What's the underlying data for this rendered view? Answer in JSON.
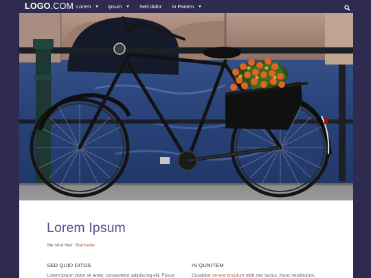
{
  "nav": {
    "logo_bold": "LOGO",
    "logo_thin": ".COM",
    "items": [
      {
        "label": "Lorem",
        "has_dropdown": true
      },
      {
        "label": "Ipsum",
        "has_dropdown": true
      },
      {
        "label": "Sed dolor",
        "has_dropdown": false
      },
      {
        "label": "In Panem",
        "has_dropdown": true
      }
    ],
    "search_icon": "search-icon"
  },
  "hero": {
    "image": "bicycle-with-tulips-on-canal-bridge"
  },
  "main": {
    "title": "Lorem Ipsum",
    "breadcrumb_prefix": "Sie sind hier:",
    "breadcrumb_link": "Startseite",
    "columns": [
      {
        "heading": "SED QUID DITOS",
        "text": "Lorem ipsum dolor sit amet, consectetur adipiscing elit. Fusce"
      },
      {
        "heading": "IN QUNITEM",
        "text_before": "Curabitur",
        "text_link": "ornare tincidunt",
        "text_after": "nibh nec luctus. Nunc vestibulum,"
      }
    ]
  },
  "colors": {
    "nav_bg": "#2f2a4f",
    "accent_title": "#4f5191",
    "link": "#b0523e"
  }
}
